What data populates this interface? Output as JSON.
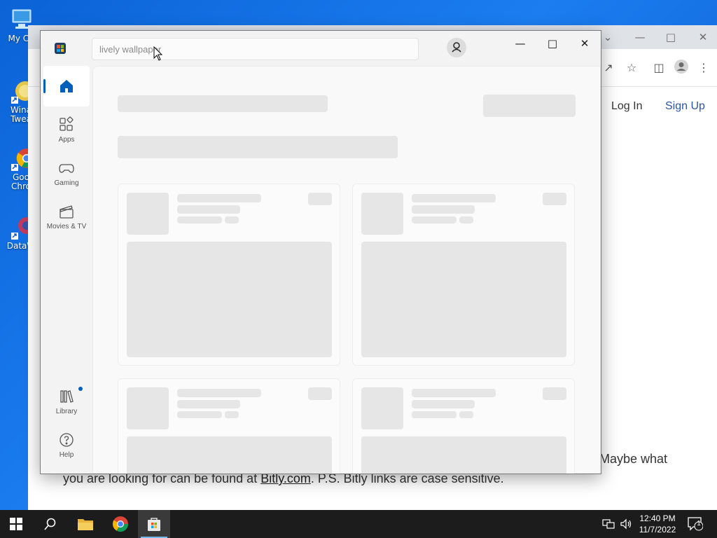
{
  "desktop": {
    "icons": [
      {
        "name": "my-computer-icon",
        "label": "My Co"
      },
      {
        "name": "winaero-tweaker-icon",
        "label": "Wina\nTwea"
      },
      {
        "name": "google-chrome-icon",
        "label": "Goo\nChro"
      },
      {
        "name": "datawrapper-icon",
        "label": "DataW"
      }
    ]
  },
  "browser": {
    "login": "Log In",
    "signup": "Sign Up",
    "message_line1_tail": "Maybe what",
    "message_line2_pre": "you are looking for can be found at ",
    "message_link": "Bitly.com",
    "message_line2_post": ". P.S. Bitly links are case sensitive."
  },
  "store": {
    "search_value": "lively wallpaper",
    "nav": [
      {
        "id": "home",
        "label": "",
        "active": true
      },
      {
        "id": "apps",
        "label": "Apps"
      },
      {
        "id": "gaming",
        "label": "Gaming"
      },
      {
        "id": "movies",
        "label": "Movies & TV"
      },
      {
        "id": "library",
        "label": "Library",
        "badge": true
      },
      {
        "id": "help",
        "label": "Help"
      }
    ],
    "accent": "#005fb8"
  },
  "taskbar": {
    "time": "12:40 PM",
    "date": "11/7/2022",
    "notifications": "1"
  }
}
